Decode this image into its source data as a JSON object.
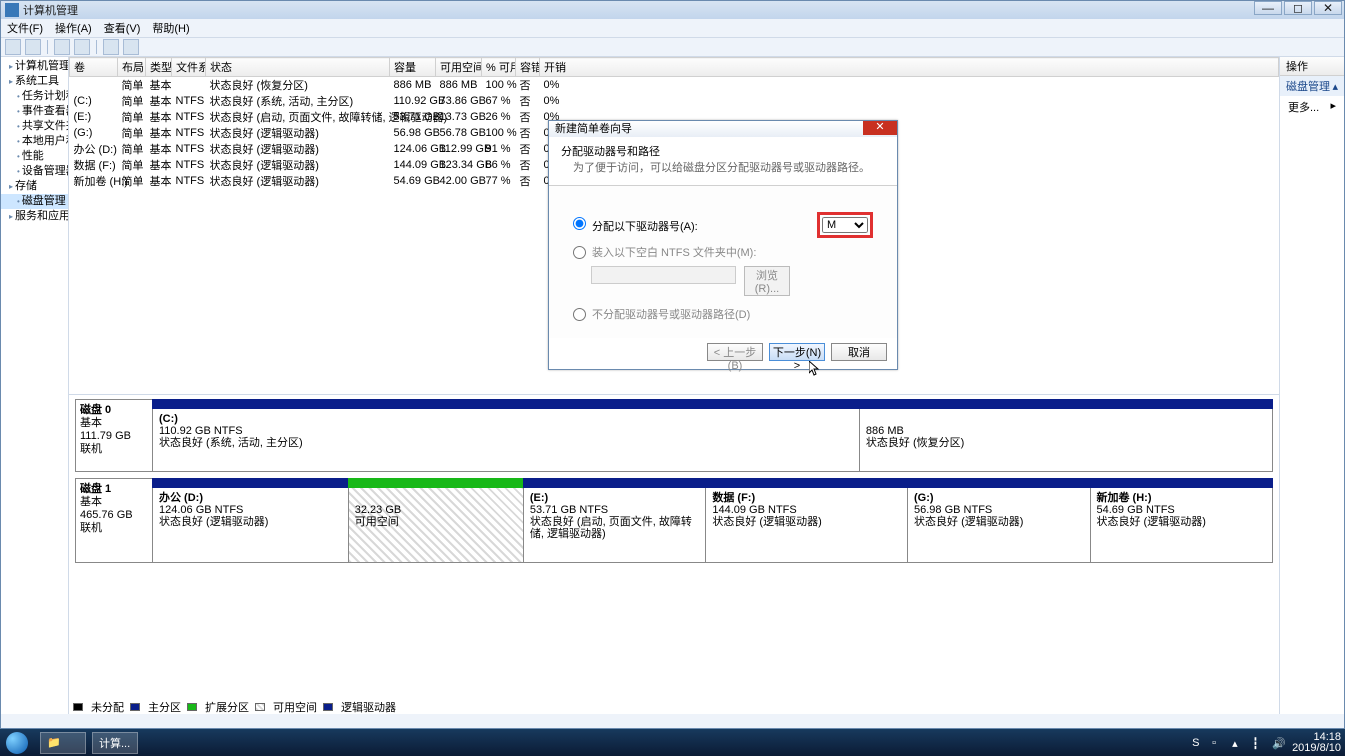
{
  "window": {
    "title": "计算机管理"
  },
  "menu": {
    "file": "文件(F)",
    "action": "操作(A)",
    "view": "查看(V)",
    "help": "帮助(H)"
  },
  "tree": {
    "root": "计算机管理(本",
    "n0": "系统工具",
    "n1": "任务计划程",
    "n2": "事件查看器",
    "n3": "共享文件夹",
    "n4": "本地用户和",
    "n5": "性能",
    "n6": "设备管理器",
    "n7": "存储",
    "n8": "磁盘管理",
    "n9": "服务和应用程"
  },
  "cols": {
    "vol": "卷",
    "layout": "布局",
    "type": "类型",
    "fs": "文件系统",
    "status": "状态",
    "cap": "容量",
    "free": "可用空间",
    "pct": "% 可用",
    "fault": "容错",
    "over": "开销"
  },
  "rows": [
    {
      "vol": "",
      "layout": "简单",
      "type": "基本",
      "fs": "",
      "status": "状态良好 (恢复分区)",
      "cap": "886 MB",
      "free": "886 MB",
      "pct": "100 %",
      "fault": "否",
      "over": "0%"
    },
    {
      "vol": "(C:)",
      "layout": "简单",
      "type": "基本",
      "fs": "NTFS",
      "status": "状态良好 (系统, 活动, 主分区)",
      "cap": "110.92 GB",
      "free": "73.86 GB",
      "pct": "67 %",
      "fault": "否",
      "over": "0%"
    },
    {
      "vol": "(E:)",
      "layout": "简单",
      "type": "基本",
      "fs": "NTFS",
      "status": "状态良好 (启动, 页面文件, 故障转储, 逻辑驱动器)",
      "cap": "53.71 GB",
      "free": "13.73 GB",
      "pct": "26 %",
      "fault": "否",
      "over": "0%"
    },
    {
      "vol": "(G:)",
      "layout": "简单",
      "type": "基本",
      "fs": "NTFS",
      "status": "状态良好 (逻辑驱动器)",
      "cap": "56.98 GB",
      "free": "56.78 GB",
      "pct": "100 %",
      "fault": "否",
      "over": "0%"
    },
    {
      "vol": "办公 (D:)",
      "layout": "简单",
      "type": "基本",
      "fs": "NTFS",
      "status": "状态良好 (逻辑驱动器)",
      "cap": "124.06 GB",
      "free": "112.99 GB",
      "pct": "91 %",
      "fault": "否",
      "over": "0%"
    },
    {
      "vol": "数据 (F:)",
      "layout": "简单",
      "type": "基本",
      "fs": "NTFS",
      "status": "状态良好 (逻辑驱动器)",
      "cap": "144.09 GB",
      "free": "123.34 GB",
      "pct": "86 %",
      "fault": "否",
      "over": "0%"
    },
    {
      "vol": "新加卷 (H:)",
      "layout": "简单",
      "type": "基本",
      "fs": "NTFS",
      "status": "状态良好 (逻辑驱动器)",
      "cap": "54.69 GB",
      "free": "42.00 GB",
      "pct": "77 %",
      "fault": "否",
      "over": "0%"
    }
  ],
  "disk0": {
    "name": "磁盘 0",
    "type": "基本",
    "size": "111.79 GB",
    "state": "联机",
    "p0": {
      "title": "(C:)",
      "line1": "110.92 GB NTFS",
      "line2": "状态良好 (系统, 活动, 主分区)"
    },
    "p1": {
      "title": "",
      "line1": "886 MB",
      "line2": "状态良好 (恢复分区)"
    }
  },
  "disk1": {
    "name": "磁盘 1",
    "type": "基本",
    "size": "465.76 GB",
    "state": "联机",
    "p0": {
      "title": "办公  (D:)",
      "line1": "124.06 GB NTFS",
      "line2": "状态良好 (逻辑驱动器)"
    },
    "p1": {
      "title": "",
      "line1": "32.23 GB",
      "line2": "可用空间"
    },
    "p2": {
      "title": "(E:)",
      "line1": "53.71 GB NTFS",
      "line2": "状态良好 (启动, 页面文件, 故障转储, 逻辑驱动器)"
    },
    "p3": {
      "title": "数据  (F:)",
      "line1": "144.09 GB NTFS",
      "line2": "状态良好 (逻辑驱动器)"
    },
    "p4": {
      "title": "(G:)",
      "line1": "56.98 GB NTFS",
      "line2": "状态良好 (逻辑驱动器)"
    },
    "p5": {
      "title": "新加卷  (H:)",
      "line1": "54.69 GB NTFS",
      "line2": "状态良好 (逻辑驱动器)"
    }
  },
  "legend": {
    "l0": "未分配",
    "l1": "主分区",
    "l2": "扩展分区",
    "l3": "可用空间",
    "l4": "逻辑驱动器"
  },
  "actions": {
    "hd": "操作",
    "sec": "磁盘管理",
    "more": "更多..."
  },
  "dialog": {
    "title": "新建简单卷向导",
    "h1": "分配驱动器号和路径",
    "h2": "为了便于访问，可以给磁盘分区分配驱动器号或驱动器路径。",
    "r1": "分配以下驱动器号(A):",
    "r2": "装入以下空白 NTFS 文件夹中(M):",
    "r3": "不分配驱动器号或驱动器路径(D)",
    "drive": "M",
    "browse": "浏览(R)...",
    "prev": "< 上一步(B)",
    "next": "下一步(N) >",
    "cancel": "取消"
  },
  "taskbar": {
    "app": "计算...",
    "time": "14:18",
    "date": "2019/8/10"
  }
}
